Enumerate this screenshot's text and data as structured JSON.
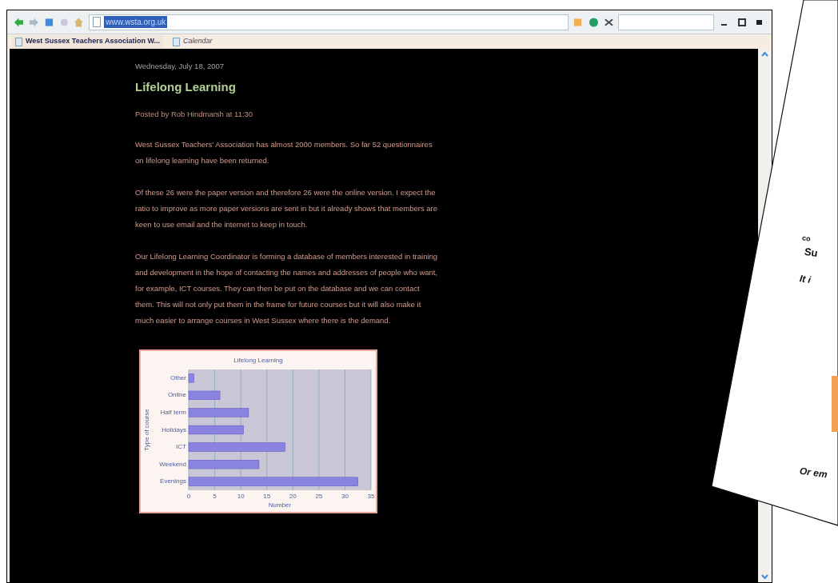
{
  "browser": {
    "address": "www.wsta.org.uk",
    "tabs": [
      {
        "label": "West Sussex Teachers Association W...",
        "selected": true
      },
      {
        "label": "Calendar",
        "selected": false
      }
    ]
  },
  "post": {
    "date": "Wednesday, July 18, 2007",
    "title": "Lifelong Learning",
    "byline": "Posted by Rob Hindmarsh at 11:30",
    "paragraphs": [
      "West Sussex Teachers' Association has almost 2000 members. So far 52 questionnaires on lifelong learning have been returned.",
      "Of these 26 were the paper version and therefore 26 were the online version. I expect the ratio to improve as more paper versions are sent in but it already shows that members are keen to use email and the internet to keep in touch.",
      "Our Lifelong Learning Coordinator is forming a database of members interested in training and development in the hope of contacting the names and addresses of people who want, for example, ICT courses. They can then be put on the database and we can contact them. This will not only put them in the frame for future courses but it will also make it much easier to arrange courses in West Sussex where there is the demand."
    ],
    "chart_data": {
      "type": "bar",
      "orientation": "horizontal",
      "title": "Lifelong Learning",
      "xlabel": "Number",
      "ylabel": "Type of course",
      "categories": [
        "Other",
        "Online",
        "Half term",
        "Holidays",
        "ICT",
        "Weekend",
        "Evenings"
      ],
      "series": [
        {
          "color": "#8a84e0",
          "values": [
            1,
            6,
            11.5,
            10.5,
            18.5,
            13.5,
            32.5
          ]
        }
      ],
      "grid": true,
      "xlim": [
        0,
        35
      ],
      "xticks": [
        0,
        5,
        10,
        15,
        20,
        25,
        30,
        35
      ]
    }
  },
  "paper": {
    "texts": [
      "co",
      "Su",
      "It i",
      "Or em"
    ]
  }
}
